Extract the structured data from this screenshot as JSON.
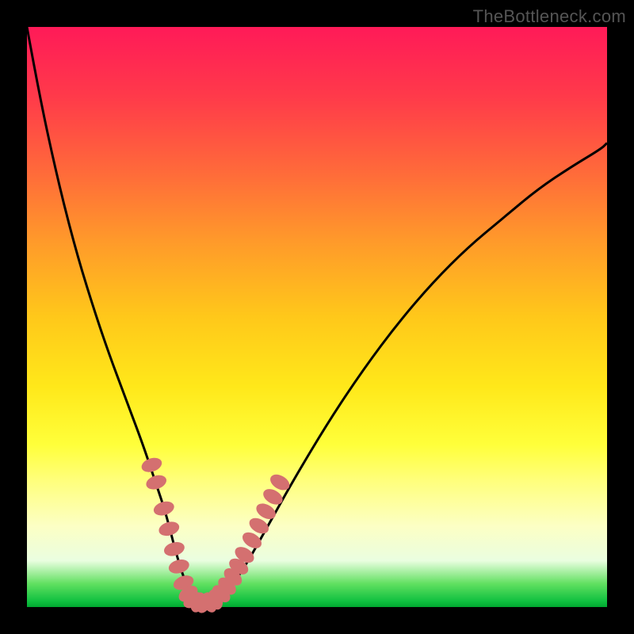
{
  "watermark": "TheBottleneck.com",
  "chart_data": {
    "type": "line",
    "title": "",
    "xlabel": "",
    "ylabel": "",
    "xlim": [
      0,
      100
    ],
    "ylim": [
      0,
      100
    ],
    "series": [
      {
        "name": "bottleneck-curve",
        "x": [
          0,
          2,
          5,
          8,
          11,
          14,
          17,
          20,
          22,
          24,
          25.5,
          27,
          28.5,
          30,
          32,
          34,
          37,
          41,
          46,
          52,
          58,
          64,
          70,
          76,
          82,
          88,
          94,
          99,
          100
        ],
        "values": [
          100,
          89,
          75,
          63,
          53,
          44,
          36,
          28,
          22,
          16,
          10,
          5,
          2,
          0.5,
          0.5,
          2,
          6,
          13,
          22,
          32,
          41,
          49,
          56,
          62,
          67,
          72,
          76,
          79,
          80
        ]
      }
    ],
    "markers": {
      "name": "bead-markers",
      "points": [
        {
          "x": 21.5,
          "y": 24.5,
          "r": 1.2
        },
        {
          "x": 22.3,
          "y": 21.5,
          "r": 1.2
        },
        {
          "x": 23.6,
          "y": 17.0,
          "r": 1.2
        },
        {
          "x": 24.5,
          "y": 13.5,
          "r": 1.2
        },
        {
          "x": 25.4,
          "y": 10.0,
          "r": 1.2
        },
        {
          "x": 26.2,
          "y": 7.0,
          "r": 1.2
        },
        {
          "x": 27.0,
          "y": 4.2,
          "r": 1.2
        },
        {
          "x": 27.8,
          "y": 2.3,
          "r": 1.2
        },
        {
          "x": 28.6,
          "y": 1.2,
          "r": 1.2
        },
        {
          "x": 29.5,
          "y": 0.8,
          "r": 1.2
        },
        {
          "x": 30.5,
          "y": 0.7,
          "r": 1.2
        },
        {
          "x": 31.5,
          "y": 0.8,
          "r": 1.2
        },
        {
          "x": 32.5,
          "y": 1.3,
          "r": 1.2
        },
        {
          "x": 33.5,
          "y": 2.3,
          "r": 1.2
        },
        {
          "x": 34.5,
          "y": 3.6,
          "r": 1.2
        },
        {
          "x": 35.5,
          "y": 5.2,
          "r": 1.2
        },
        {
          "x": 36.5,
          "y": 7.0,
          "r": 1.2
        },
        {
          "x": 37.5,
          "y": 9.0,
          "r": 1.2
        },
        {
          "x": 38.8,
          "y": 11.5,
          "r": 1.2
        },
        {
          "x": 40.0,
          "y": 14.0,
          "r": 1.2
        },
        {
          "x": 41.2,
          "y": 16.5,
          "r": 1.2
        },
        {
          "x": 42.4,
          "y": 19.0,
          "r": 1.2
        },
        {
          "x": 43.6,
          "y": 21.5,
          "r": 1.2
        }
      ]
    },
    "gradient_stops": [
      {
        "pos": 0,
        "color": "#ff1a58"
      },
      {
        "pos": 25,
        "color": "#ff6a3a"
      },
      {
        "pos": 50,
        "color": "#ffc81a"
      },
      {
        "pos": 72,
        "color": "#ffff3a"
      },
      {
        "pos": 92,
        "color": "#eafee0"
      },
      {
        "pos": 100,
        "color": "#00a830"
      }
    ]
  }
}
